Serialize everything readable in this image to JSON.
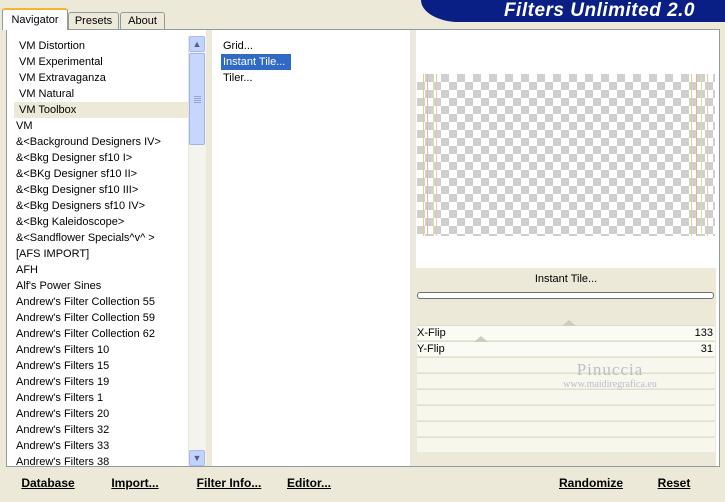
{
  "tabs": [
    "Navigator",
    "Presets",
    "About"
  ],
  "brand": {
    "title": "Filters Unlimited 2.0"
  },
  "categories": [
    "VM Distortion",
    "VM Experimental",
    "VM Extravaganza",
    "VM Natural",
    "VM Toolbox",
    "VM",
    "&<Background Designers IV>",
    "&<Bkg Designer sf10 I>",
    "&<BKg Designer sf10 II>",
    "&<Bkg Designer sf10 III>",
    "&<Bkg Designers sf10 IV>",
    "&<Bkg Kaleidoscope>",
    "&<Sandflower Specials^v^ >",
    "[AFS IMPORT]",
    "AFH",
    "Alf's Power Sines",
    "Andrew's Filter Collection 55",
    "Andrew's Filter Collection 59",
    "Andrew's Filter Collection 62",
    "Andrew's Filters 10",
    "Andrew's Filters 15",
    "Andrew's Filters 19",
    "Andrew's Filters 1",
    "Andrew's Filters 20",
    "Andrew's Filters 32",
    "Andrew's Filters 33",
    "Andrew's Filters 38"
  ],
  "selected_category": "VM Toolbox",
  "filters": [
    "Grid...",
    "Instant Tile...",
    "Tiler..."
  ],
  "selected_filter": "Instant Tile...",
  "filter_title": "Instant Tile...",
  "params": [
    {
      "label": "X-Flip",
      "value": "133",
      "level": 0.52
    },
    {
      "label": "Y-Flip",
      "value": "31",
      "level": 0.12
    }
  ],
  "watermark": {
    "line1": "Pinuccia",
    "line2": "www.maidiregrafica.eu"
  },
  "buttons": {
    "database": "Database",
    "import": "Import...",
    "filter_info": "Filter Info...",
    "editor": "Editor...",
    "randomize": "Randomize",
    "reset": "Reset"
  },
  "colors": {
    "brand_bg": "#0a1f86",
    "selection": "#316ac5",
    "panel": "#ece9d8"
  }
}
